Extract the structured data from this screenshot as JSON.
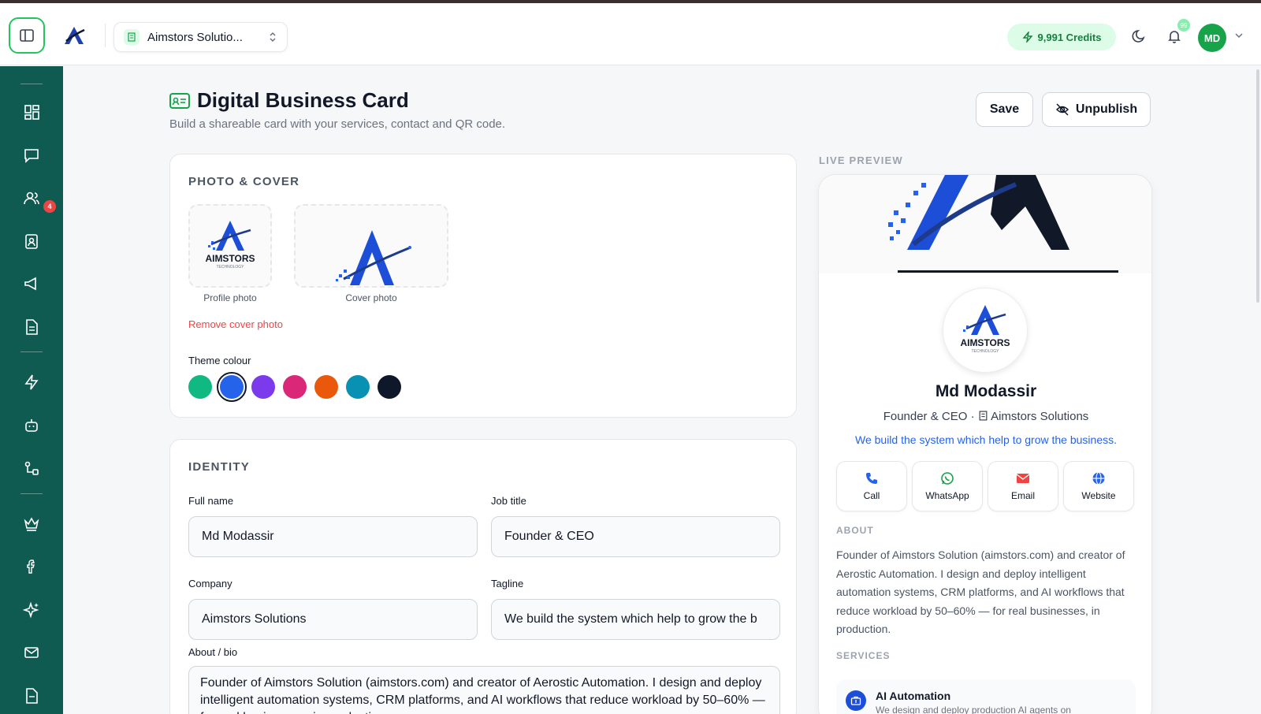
{
  "header": {
    "org_name": "Aimstors Solutio...",
    "credits": "9,991 Credits",
    "avatar_initials": "MD",
    "notification_count": "99",
    "icons": [
      "sidebar-toggle-icon",
      "brand-logo-icon",
      "building-icon",
      "chevron-updown-icon",
      "lightning-icon",
      "moon-icon",
      "bell-icon",
      "chevron-down-icon"
    ]
  },
  "sidebar": {
    "chat_badge": "4",
    "items": [
      "dashboard-icon",
      "chat-icon",
      "users-icon",
      "contact-card-icon",
      "megaphone-icon",
      "document-icon",
      "lightning-icon",
      "bot-icon",
      "workflow-icon",
      "crown-icon",
      "facebook-icon",
      "sparkle-icon",
      "mail-icon",
      "file-icon"
    ],
    "accent_color": "#0f5b52"
  },
  "page": {
    "title": "Digital Business Card",
    "subtitle": "Build a shareable card with your services, contact and QR code.",
    "save_label": "Save",
    "unpublish_label": "Unpublish"
  },
  "photo_cover": {
    "section_title": "PHOTO & COVER",
    "profile_label": "Profile photo",
    "cover_label": "Cover photo",
    "logo_text": "AIMSTORS",
    "logo_sub": "TECHNOLOGY",
    "remove_cover": "Remove cover photo",
    "theme_label": "Theme colour",
    "theme_colors": [
      "#10b981",
      "#2563eb",
      "#7c3aed",
      "#db2777",
      "#ea580c",
      "#0891b2",
      "#0f172a"
    ],
    "selected_color": "#2563eb"
  },
  "identity": {
    "section_title": "IDENTITY",
    "full_name_label": "Full name",
    "full_name": "Md Modassir",
    "job_title_label": "Job title",
    "job_title": "Founder & CEO",
    "company_label": "Company",
    "company": "Aimstors Solutions",
    "tagline_label": "Tagline",
    "tagline": "We build the system which help to grow the b",
    "about_label": "About / bio",
    "about": "Founder of Aimstors Solution (aimstors.com) and creator of Aerostic Automation. I design and deploy intelligent automation systems, CRM platforms, and AI workflows that reduce workload by 50–60% — for real businesses, in production."
  },
  "preview": {
    "label": "LIVE PREVIEW",
    "name": "Md Modassir",
    "role": "Founder & CEO",
    "company": "Aimstors Solutions",
    "tagline": "We build the system which help to grow the business.",
    "actions": [
      "Call",
      "WhatsApp",
      "Email",
      "Website"
    ],
    "about_title": "ABOUT",
    "about": "Founder of Aimstors Solution (aimstors.com) and creator of Aerostic Automation. I design and deploy intelligent automation systems, CRM platforms, and AI workflows that reduce workload by 50–60% — for real businesses, in production.",
    "services_title": "SERVICES",
    "service_title": "AI Automation",
    "service_desc": "We design and deploy production AI agents on"
  }
}
